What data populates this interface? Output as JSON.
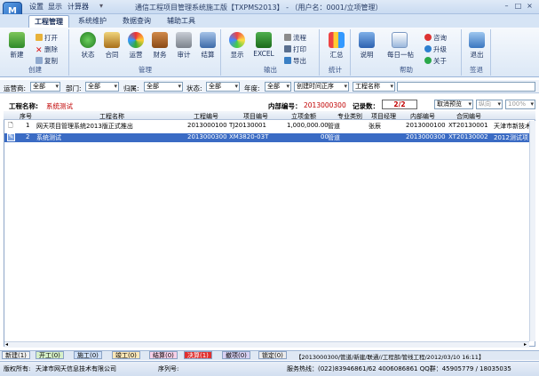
{
  "titlebar": {
    "app_icon": "M",
    "quick_access": [
      "设置",
      "显示",
      "计算器"
    ],
    "title": "通信工程项目管理系统施工版【TXPMS2013】 - （用户名：0001/立项管理）",
    "min": "–",
    "max": "□",
    "close": "×"
  },
  "tabs": [
    "工程管理",
    "系统维护",
    "数据查询",
    "辅助工具"
  ],
  "ribbon": {
    "groups": {
      "create": "创建",
      "manage": "管理",
      "output": "输出",
      "stats": "统计",
      "help": "帮助",
      "sign": "签退"
    },
    "buttons": {
      "new": "新建",
      "open": "打开",
      "delete": "删除",
      "copy": "复制",
      "status": "状态",
      "contract": "合同",
      "operation": "运营",
      "finance": "财务",
      "audit": "审计",
      "settle": "结算",
      "display": "显示",
      "excel": "EXCEL",
      "flow": "流程",
      "print": "打印",
      "export": "导出",
      "summary": "汇总",
      "explain": "说明",
      "daily_tip": "每日一帖",
      "consult": "咨询",
      "upgrade": "升级",
      "about": "关于",
      "logout": "退出"
    }
  },
  "filters": {
    "operator_label": "运营商:",
    "operator": "全部",
    "dept_label": "部门:",
    "dept": "全部",
    "owner_label": "归属:",
    "owner": "全部",
    "state_label": "状态:",
    "state": "全部",
    "year_label": "年度:",
    "year": "全部",
    "sort": "创建时间正序",
    "field": "工程名称",
    "search_value": ""
  },
  "info": {
    "project_name_label": "工程名称:",
    "project_name": "系统测试",
    "internal_no_label": "内部编号：",
    "internal_no": "2013000300",
    "record_count_label": "记录数：",
    "record_count": "2/2",
    "cancel_preview": "取消预览",
    "portrait": "纵向",
    "zoom": "100%"
  },
  "table": {
    "headers": [
      "序号",
      "工程名称",
      "工程编号",
      "项目编号",
      "立项金额",
      "专业类别",
      "项目经理",
      "内部编号",
      "合同编号"
    ],
    "rows": [
      {
        "no": "1",
        "name": "网天项目管理系统2013版正式推出",
        "code": "2013000100",
        "item": "TJ20130001",
        "amount": "1,000,000.00",
        "category": "管道",
        "manager": "张辰",
        "internal": "2013000100",
        "contract": "XT20130001",
        "client": "天津市新技术"
      },
      {
        "no": "2",
        "name": "系统测试",
        "code": "2013000300",
        "item": "XM3820-03T",
        "amount": "00",
        "category": "管道",
        "manager": "",
        "internal": "2013000300",
        "contract": "XT20130002",
        "client": "2012测试项目"
      }
    ]
  },
  "status_tabs": [
    "新建(1)",
    "开工(0)",
    "施工(0)",
    "竣工(0)",
    "结算(0)",
    "决算(1)",
    "撤项(0)",
    "锁定(0)"
  ],
  "status_path": "【2013000300/管道/新建/联通//工程部/管线工程/2012/03/10 16:11】",
  "footer": {
    "copyright_label": "版权所有:",
    "company": "天津市网天信息技术有限公司",
    "serial_label": "序列号:",
    "service": "服务热线：(022)83946861/62   4006086861   QQ群：45905779 / 18035035"
  },
  "colors": {
    "accent": "#3a6bc4",
    "red_text": "#c00000"
  }
}
